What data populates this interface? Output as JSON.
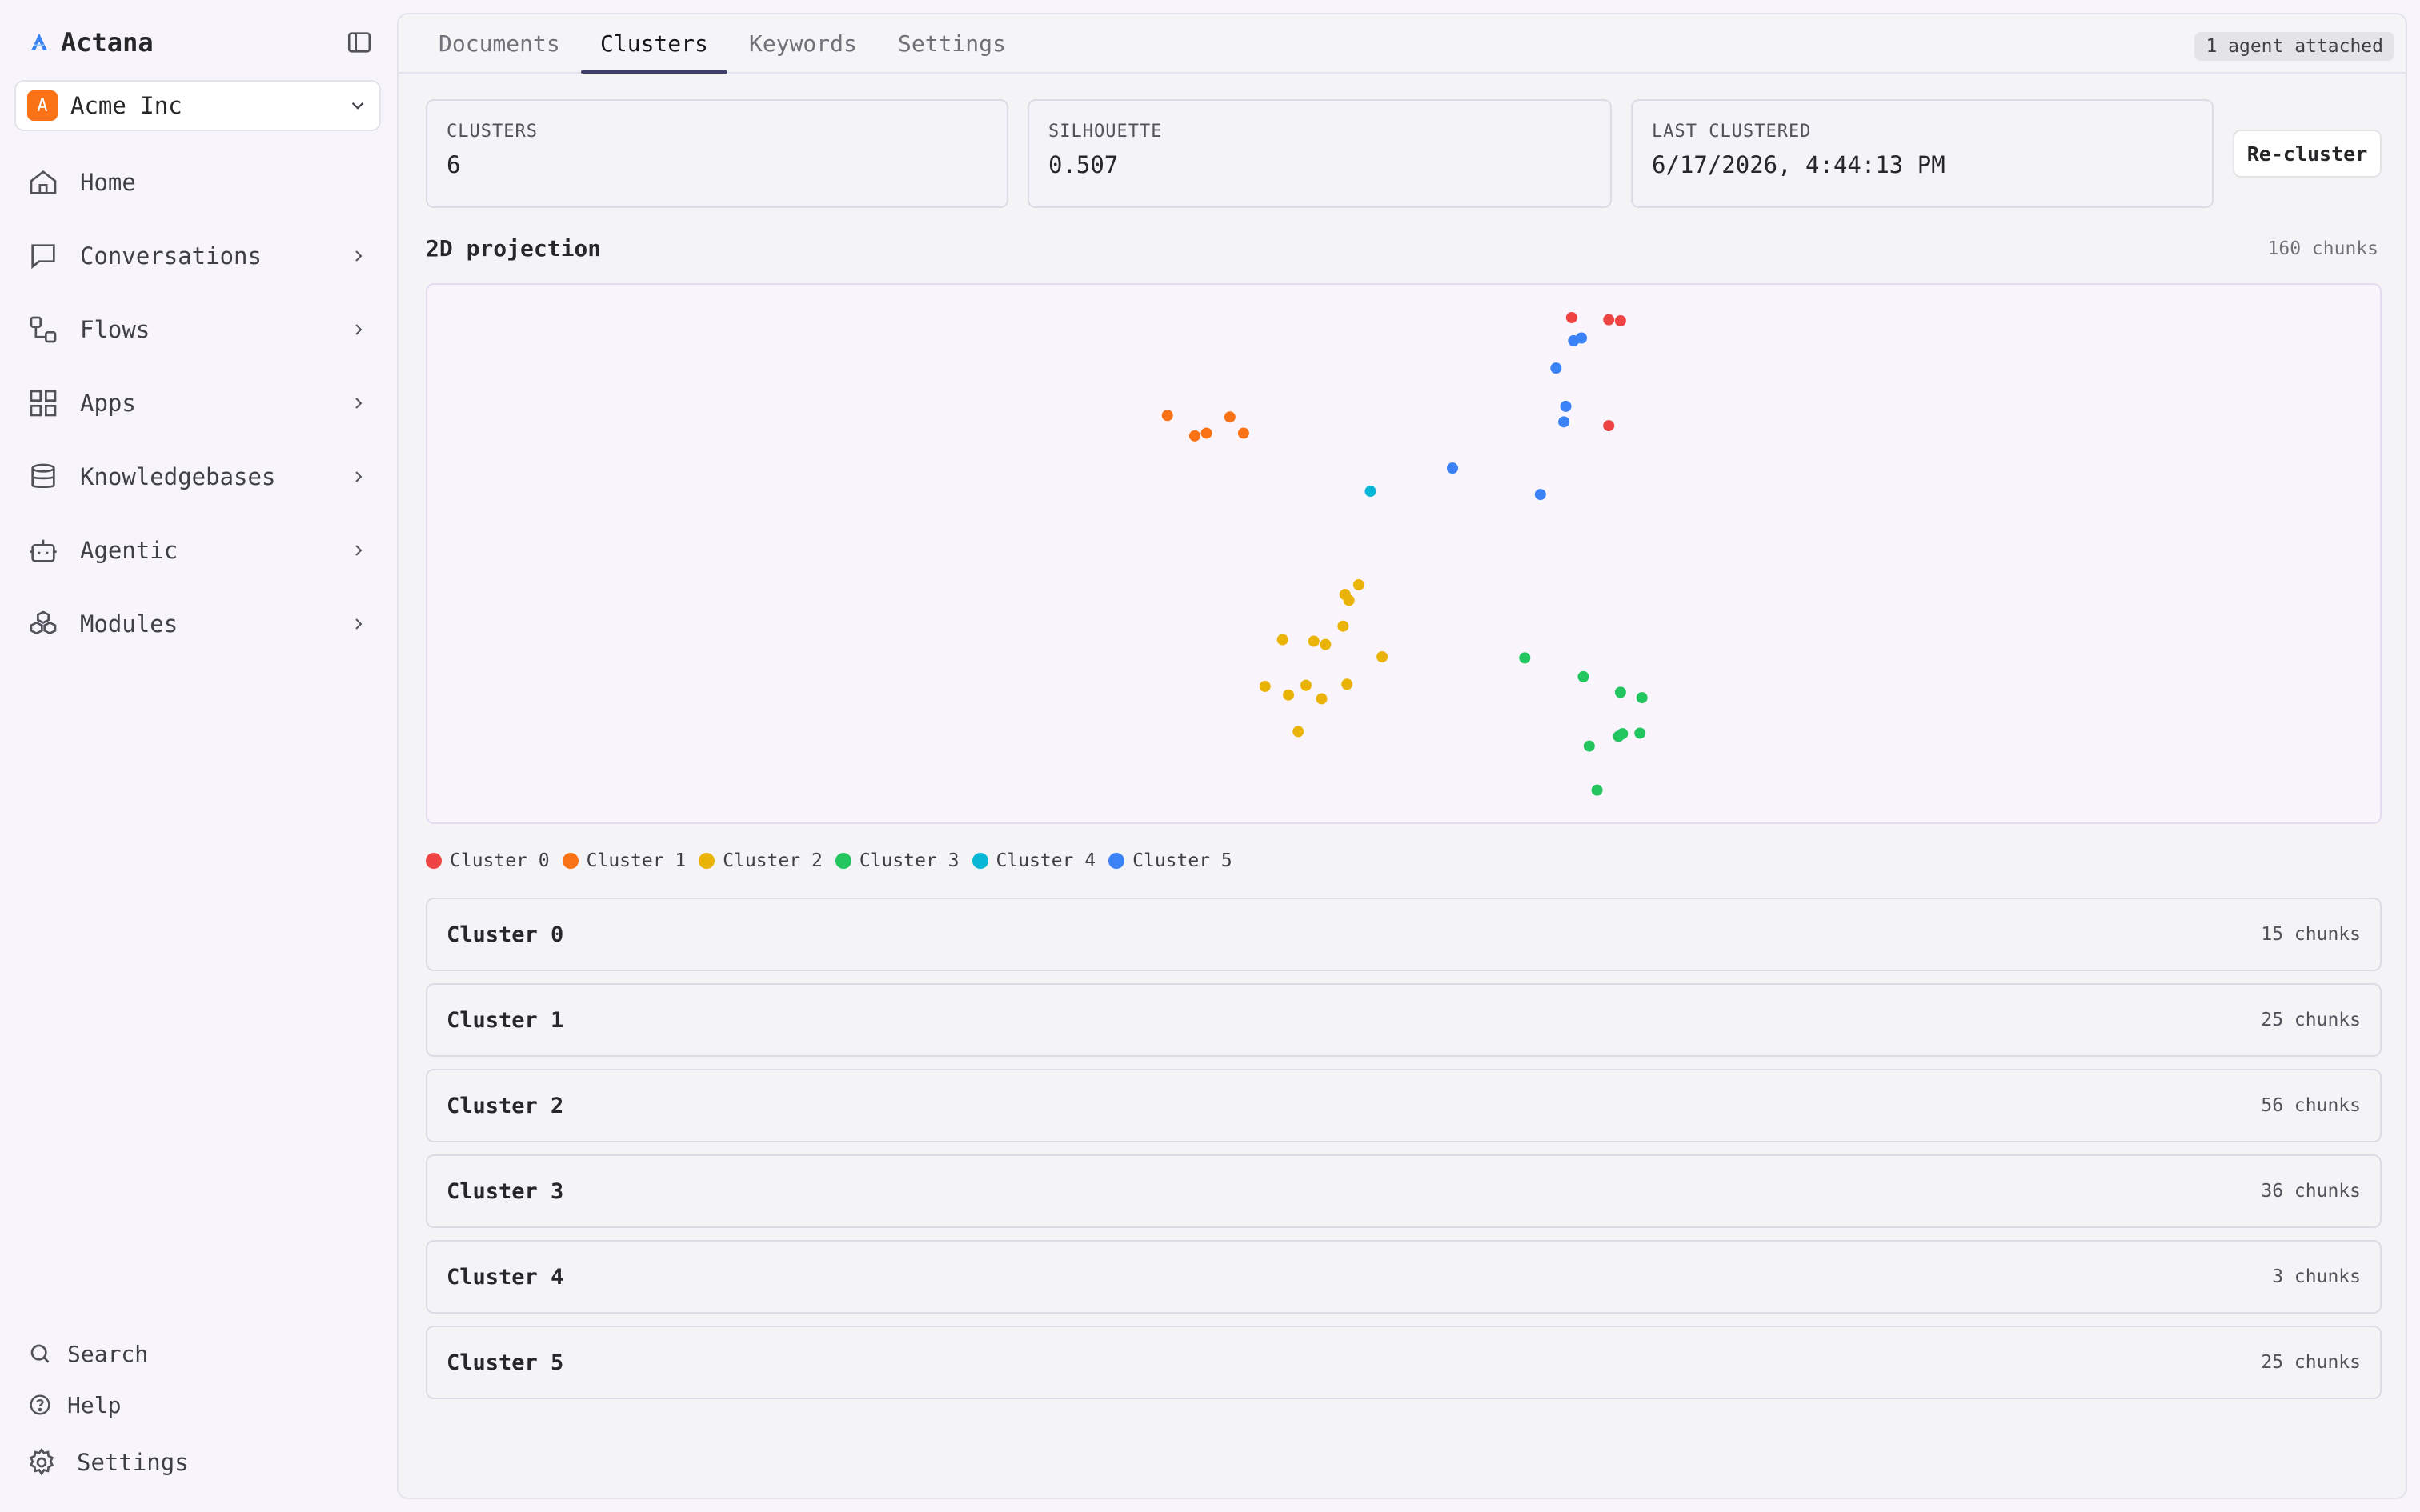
{
  "brand": {
    "name": "Actana",
    "accent": "#3b82f6"
  },
  "org": {
    "initial": "A",
    "name": "Acme Inc",
    "color": "#f97316"
  },
  "nav": [
    {
      "label": "Home",
      "icon": "home-icon",
      "has_children": false
    },
    {
      "label": "Conversations",
      "icon": "chat-icon",
      "has_children": true
    },
    {
      "label": "Flows",
      "icon": "flow-icon",
      "has_children": true
    },
    {
      "label": "Apps",
      "icon": "apps-grid-icon",
      "has_children": true
    },
    {
      "label": "Knowledgebases",
      "icon": "database-icon",
      "has_children": true
    },
    {
      "label": "Agentic",
      "icon": "bot-icon",
      "has_children": true
    },
    {
      "label": "Modules",
      "icon": "modules-icon",
      "has_children": true
    }
  ],
  "bottom": {
    "search": "Search",
    "help": "Help",
    "settings": "Settings"
  },
  "tabs": [
    {
      "label": "Documents",
      "active": false
    },
    {
      "label": "Clusters",
      "active": true
    },
    {
      "label": "Keywords",
      "active": false
    },
    {
      "label": "Settings",
      "active": false
    }
  ],
  "agent_badge": "1 agent attached",
  "stats": {
    "clusters": {
      "label": "CLUSTERS",
      "value": "6"
    },
    "silhouette": {
      "label": "SILHOUETTE",
      "value": "0.507"
    },
    "last_clustered": {
      "label": "LAST CLUSTERED",
      "value": "6/17/2026, 4:44:13 PM"
    }
  },
  "recluster_label": "Re-cluster",
  "projection": {
    "title": "2D projection",
    "count": "160 chunks"
  },
  "clusters": [
    {
      "name": "Cluster 0",
      "count": "15 chunks",
      "color": "#ef4444"
    },
    {
      "name": "Cluster 1",
      "count": "25 chunks",
      "color": "#f97316"
    },
    {
      "name": "Cluster 2",
      "count": "56 chunks",
      "color": "#eab308"
    },
    {
      "name": "Cluster 3",
      "count": "36 chunks",
      "color": "#22c55e"
    },
    {
      "name": "Cluster 4",
      "count": "3 chunks",
      "color": "#06b6d4"
    },
    {
      "name": "Cluster 5",
      "count": "25 chunks",
      "color": "#3b82f6"
    }
  ],
  "chart_data": {
    "type": "scatter",
    "title": "2D projection",
    "xlabel": "",
    "ylabel": "",
    "grid": false,
    "legend": "bottom-left",
    "xlim": [
      0,
      1
    ],
    "ylim": [
      0,
      1
    ],
    "series": [
      {
        "name": "Cluster 0",
        "color": "#ef4444",
        "points": [
          [
            0.586,
            0.939
          ],
          [
            0.605,
            0.935
          ],
          [
            0.611,
            0.933
          ],
          [
            0.605,
            0.738
          ]
        ]
      },
      {
        "name": "Cluster 1",
        "color": "#f97316",
        "points": [
          [
            0.379,
            0.757
          ],
          [
            0.393,
            0.719
          ],
          [
            0.399,
            0.724
          ],
          [
            0.411,
            0.754
          ],
          [
            0.418,
            0.724
          ]
        ]
      },
      {
        "name": "Cluster 2",
        "color": "#eab308",
        "points": [
          [
            0.477,
            0.442
          ],
          [
            0.47,
            0.424
          ],
          [
            0.472,
            0.413
          ],
          [
            0.469,
            0.365
          ],
          [
            0.454,
            0.337
          ],
          [
            0.46,
            0.331
          ],
          [
            0.438,
            0.34
          ],
          [
            0.489,
            0.308
          ],
          [
            0.471,
            0.257
          ],
          [
            0.45,
            0.255
          ],
          [
            0.429,
            0.253
          ],
          [
            0.441,
            0.237
          ],
          [
            0.458,
            0.23
          ],
          [
            0.446,
            0.169
          ]
        ]
      },
      {
        "name": "Cluster 3",
        "color": "#22c55e",
        "points": [
          [
            0.562,
            0.306
          ],
          [
            0.592,
            0.271
          ],
          [
            0.611,
            0.242
          ],
          [
            0.622,
            0.232
          ],
          [
            0.612,
            0.165
          ],
          [
            0.621,
            0.166
          ],
          [
            0.61,
            0.16
          ],
          [
            0.595,
            0.142
          ],
          [
            0.599,
            0.06
          ]
        ]
      },
      {
        "name": "Cluster 4",
        "color": "#06b6d4",
        "points": [
          [
            0.483,
            0.616
          ]
        ]
      },
      {
        "name": "Cluster 5",
        "color": "#3b82f6",
        "points": [
          [
            0.591,
            0.901
          ],
          [
            0.587,
            0.896
          ],
          [
            0.578,
            0.845
          ],
          [
            0.583,
            0.774
          ],
          [
            0.582,
            0.745
          ],
          [
            0.525,
            0.659
          ],
          [
            0.57,
            0.61
          ]
        ]
      }
    ]
  }
}
